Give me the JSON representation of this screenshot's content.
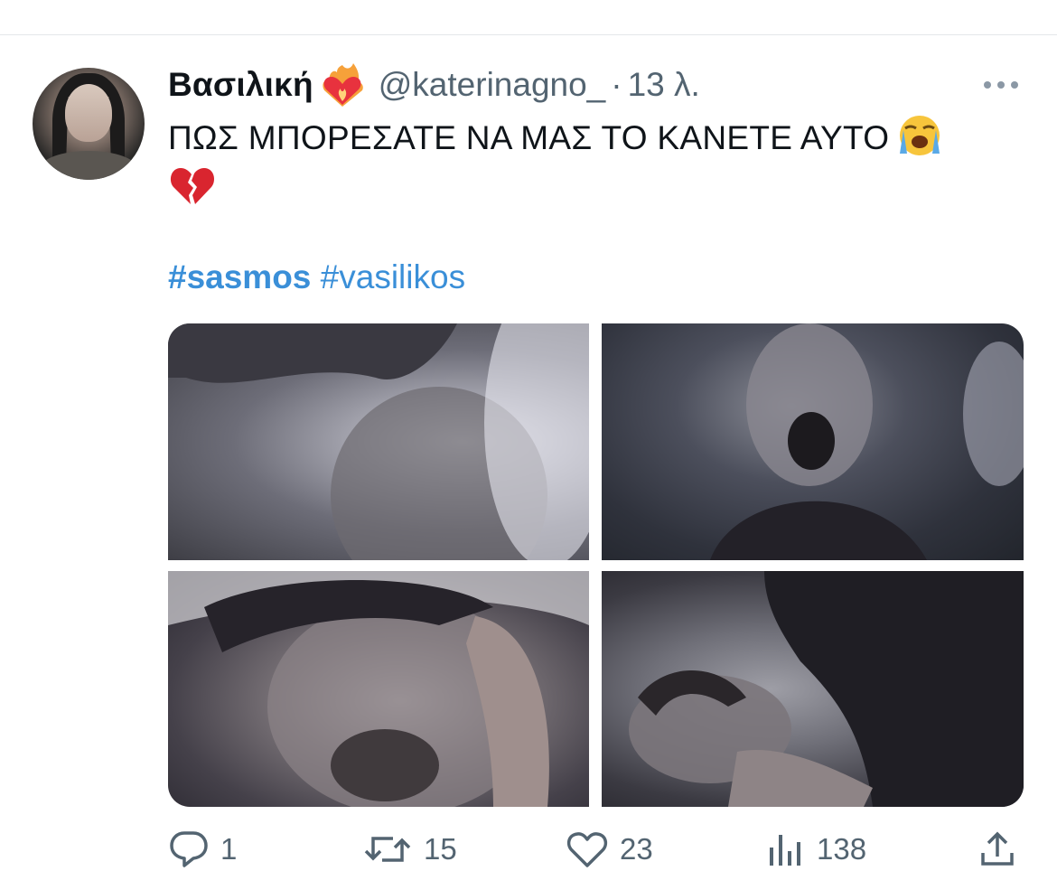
{
  "tweet": {
    "author": {
      "display_name": "Βασιλική",
      "name_emoji": "heart-on-fire-icon",
      "handle": "@katerinagno_",
      "separator": "·",
      "time": "13 λ."
    },
    "text": "ΠΩΣ ΜΠΟΡΕΣΑΤΕ ΝΑ ΜΑΣ ΤΟ ΚΑΝΕΤΕ ΑΥΤΟ",
    "text_emojis": [
      "loudly-crying-face-icon",
      "broken-heart-icon"
    ],
    "hashtags": [
      "#sasmos",
      "#vasilikos"
    ],
    "media_count": 4,
    "actions": {
      "replies": "1",
      "retweets": "15",
      "likes": "23",
      "views": "138"
    }
  },
  "colors": {
    "text": "#0f1419",
    "secondary": "#536471",
    "hashtag": "#3a8fd8",
    "divider": "#e4e7ea"
  }
}
